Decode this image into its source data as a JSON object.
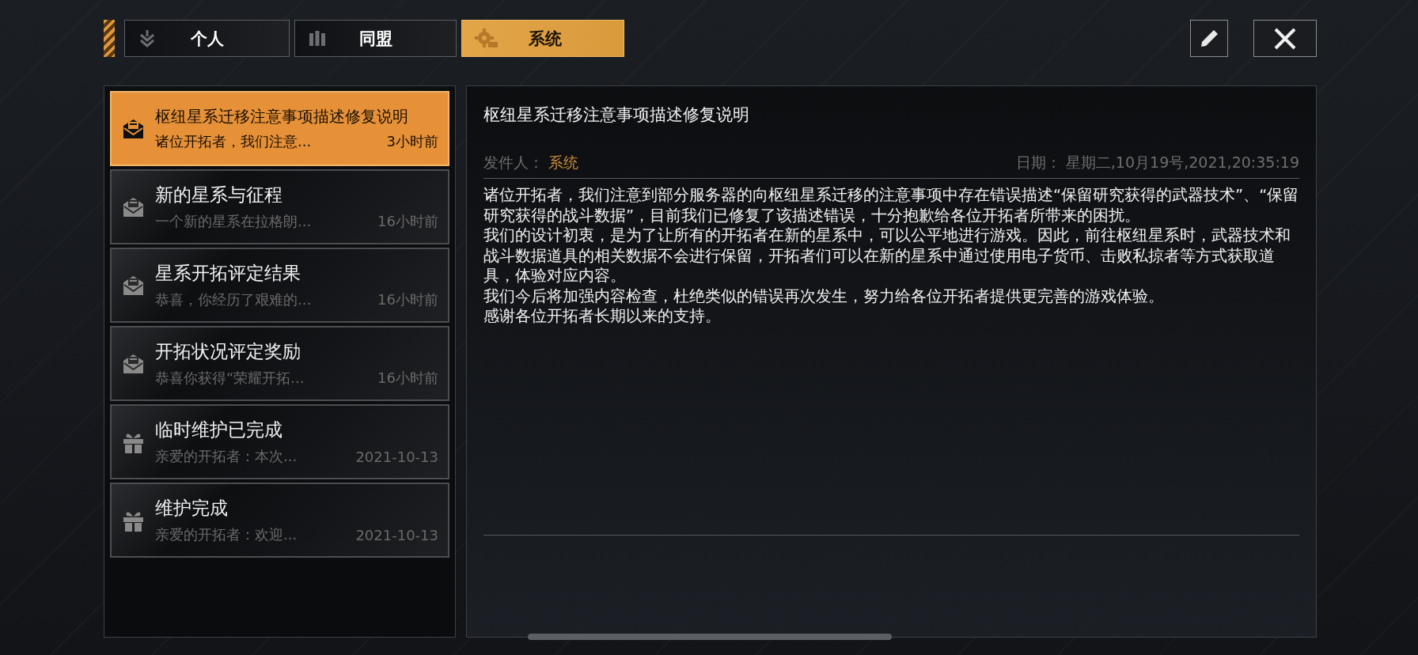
{
  "tabs": [
    {
      "label": "个人",
      "selected": false
    },
    {
      "label": "同盟",
      "selected": false
    },
    {
      "label": "系统",
      "selected": true
    }
  ],
  "mails": [
    {
      "kind": "mail",
      "title": "枢纽星系迁移注意事项描述修复说明",
      "preview": "诸位开拓者，我们注意...",
      "time": "3小时前",
      "selected": true
    },
    {
      "kind": "mail",
      "title": "新的星系与征程",
      "preview": "一个新的星系在拉格朗...",
      "time": "16小时前",
      "selected": false
    },
    {
      "kind": "mail",
      "title": "星系开拓评定结果",
      "preview": "恭喜，你经历了艰难的...",
      "time": "16小时前",
      "selected": false
    },
    {
      "kind": "mail",
      "title": "开拓状况评定奖励",
      "preview": "恭喜你获得“荣耀开拓...",
      "time": "16小时前",
      "selected": false
    },
    {
      "kind": "gift",
      "title": "临时维护已完成",
      "preview": "亲爱的开拓者：本次...",
      "time": "2021-10-13",
      "selected": false
    },
    {
      "kind": "gift",
      "title": "维护完成",
      "preview": "亲爱的开拓者：欢迎...",
      "time": "2021-10-13",
      "selected": false
    }
  ],
  "detail": {
    "title": "枢纽星系迁移注意事项描述修复说明",
    "sender_label": "发件人：",
    "sender": "系统",
    "date_label": "日期：",
    "date": "星期二,10月19号,2021,20:35:19",
    "paragraphs": [
      "诸位开拓者，我们注意到部分服务器的向枢纽星系迁移的注意事项中存在错误描述“保留研究获得的武器技术”、“保留研究获得的战斗数据”，目前我们已修复了该描述错误，十分抱歉给各位开拓者所带来的困扰。",
      "我们的设计初衷，是为了让所有的开拓者在新的星系中，可以公平地进行游戏。因此，前往枢纽星系时，武器技术和战斗数据道具的相关数据不会进行保留，开拓者们可以在新的星系中通过使用电子货币、击败私掠者等方式获取道具，体验对应内容。",
      "我们今后将加强内容检查，杜绝类似的错误再次发生，努力给各位开拓者提供更完善的游戏体验。",
      "感谢各位开拓者长期以来的支持。"
    ]
  }
}
